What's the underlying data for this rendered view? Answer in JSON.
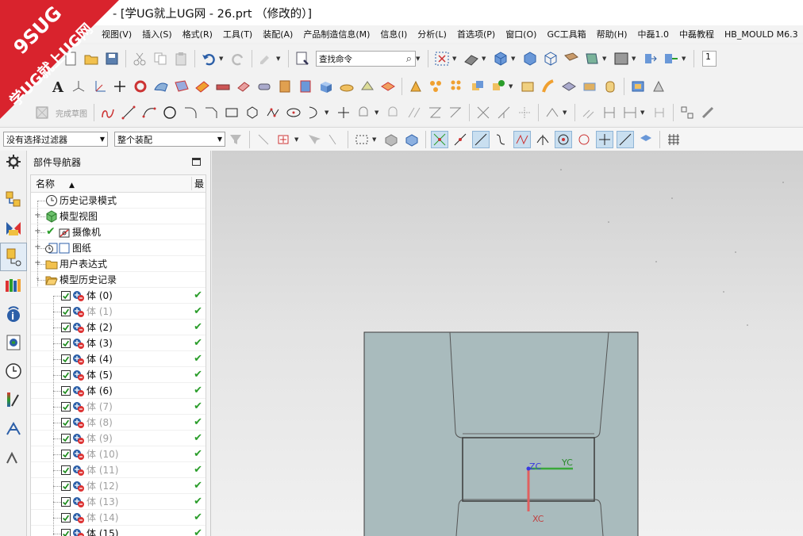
{
  "title": {
    "text": "- [学UG就上UG网 - 26.prt （修改的）]"
  },
  "watermark": {
    "line1": "9SUG",
    "line2": "学UG就上UG网"
  },
  "menu": [
    "视图(V)",
    "插入(S)",
    "格式(R)",
    "工具(T)",
    "装配(A)",
    "产品制造信息(M)",
    "信息(I)",
    "分析(L)",
    "首选项(P)",
    "窗口(O)",
    "GC工具箱",
    "帮助(H)",
    "中磊1.0",
    "中磊教程",
    "HB_MOULD M6.3"
  ],
  "toolbar": {
    "command_search_placeholder": "查找命令",
    "right_field_value": "1",
    "sketch_finish_label": "完成草图",
    "selection_filter": "没有选择过滤器",
    "assembly_scope": "整个装配"
  },
  "navigator": {
    "title": "部件导航器",
    "column_name": "名称",
    "column_latest": "最",
    "items": [
      {
        "label": "历史记录模式",
        "icon": "clock-icon",
        "level": 0,
        "expander": ""
      },
      {
        "label": "模型视图",
        "icon": "model-view-icon",
        "level": 0,
        "expander": "+"
      },
      {
        "label": "摄像机",
        "icon": "camera-icon",
        "level": 0,
        "expander": "+"
      },
      {
        "label": "图纸",
        "icon": "drawing-icon",
        "level": 0,
        "expander": "+"
      },
      {
        "label": "用户表达式",
        "icon": "folder-icon",
        "level": 0,
        "expander": "+"
      },
      {
        "label": "模型历史记录",
        "icon": "folder-open-icon",
        "level": 0,
        "expander": "-"
      }
    ],
    "bodies": [
      {
        "label": "体 (0)",
        "dim": false
      },
      {
        "label": "体 (1)",
        "dim": true
      },
      {
        "label": "体 (2)",
        "dim": false
      },
      {
        "label": "体 (3)",
        "dim": false
      },
      {
        "label": "体 (4)",
        "dim": false
      },
      {
        "label": "体 (5)",
        "dim": false
      },
      {
        "label": "体 (6)",
        "dim": false
      },
      {
        "label": "体 (7)",
        "dim": true
      },
      {
        "label": "体 (8)",
        "dim": true
      },
      {
        "label": "体 (9)",
        "dim": true
      },
      {
        "label": "体 (10)",
        "dim": true
      },
      {
        "label": "体 (11)",
        "dim": true
      },
      {
        "label": "体 (12)",
        "dim": true
      },
      {
        "label": "体 (13)",
        "dim": true
      },
      {
        "label": "体 (14)",
        "dim": true
      },
      {
        "label": "体 (15)",
        "dim": false
      }
    ]
  },
  "viewport": {
    "axes": {
      "x": "XC",
      "y": "YC",
      "z": "ZC"
    },
    "colors": {
      "part_fill": "#a9bbbd",
      "part_edge": "#3a3a3a",
      "x_axis": "#e06060",
      "y_axis": "#3aa83a",
      "z_axis": "#3a3ae0"
    }
  }
}
